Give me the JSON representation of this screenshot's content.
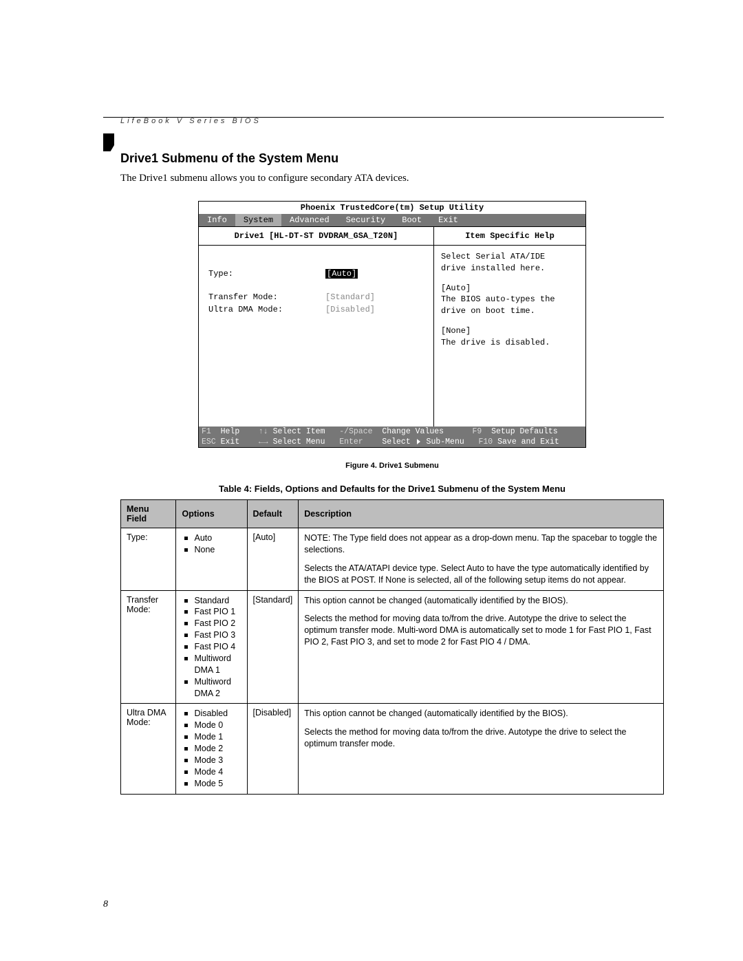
{
  "header": "LifeBook V Series BIOS",
  "section_title": "Drive1 Submenu of the System Menu",
  "lead": "The Drive1 submenu allows you to configure secondary ATA devices.",
  "bios": {
    "title": "Phoenix TrustedCore(tm) Setup Utility",
    "tabs": [
      "Info",
      "System",
      "Advanced",
      "Security",
      "Boot",
      "Exit"
    ],
    "active_tab": "System",
    "submenu_title": "Drive1 [HL-DT-ST DVDRAM_GSA_T20N]",
    "help_title": "Item Specific Help",
    "fields": [
      {
        "label": "Type:",
        "value": "[Auto]",
        "style": "highlight"
      },
      {
        "label": "Transfer Mode:",
        "value": "[Standard]",
        "style": "disabled"
      },
      {
        "label": "Ultra DMA Mode:",
        "value": "[Disabled]",
        "style": "disabled"
      }
    ],
    "help_lines": [
      "Select Serial ATA/IDE",
      "drive installed here.",
      "",
      "[Auto]",
      "The BIOS auto-types the",
      "drive on boot time.",
      "",
      "[None]",
      "The drive is disabled."
    ],
    "footer": {
      "row1": {
        "c1k": "F1",
        "c1l": "Help",
        "c2k": "↑↓",
        "c2l": "Select Item",
        "c3k": "-/Space",
        "c3l": "Change Values",
        "c4k": "F9",
        "c4l": "Setup Defaults"
      },
      "row2": {
        "c1k": "ESC",
        "c1l": "Exit",
        "c2k": "←→",
        "c2l": "Select Menu",
        "c3k": "Enter",
        "c3l": "Select ▶ Sub-Menu",
        "c4k": "F10",
        "c4l": "Save and Exit"
      }
    }
  },
  "figure_caption": "Figure 4.  Drive1 Submenu",
  "table_caption": "Table 4: Fields, Options and Defaults for the Drive1 Submenu of the System Menu",
  "table": {
    "headers": [
      "Menu Field",
      "Options",
      "Default",
      "Description"
    ],
    "rows": [
      {
        "field": "Type:",
        "options": [
          "Auto",
          "None"
        ],
        "default": "[Auto]",
        "description": [
          "NOTE: The Type field does not appear as a drop-down menu. Tap the spacebar to toggle the selections.",
          "Selects the ATA/ATAPI device type. Select Auto to have the type automatically identified by the BIOS at POST. If None is selected, all of the following setup items do not appear."
        ]
      },
      {
        "field": "Transfer Mode:",
        "options": [
          "Standard",
          "Fast PIO 1",
          "Fast PIO 2",
          "Fast PIO 3",
          "Fast PIO 4",
          "Multiword DMA 1",
          "Multiword DMA 2"
        ],
        "default": "[Standard]",
        "description": [
          "This option cannot be changed (automatically identified by the BIOS).",
          "Selects the method for moving data to/from the drive. Autotype the drive to select the optimum transfer mode.  Multi-word DMA is automatically set to mode 1 for Fast PIO 1, Fast PIO 2, Fast PIO 3, and set to mode 2 for Fast PIO 4 / DMA."
        ]
      },
      {
        "field": "Ultra DMA Mode:",
        "options": [
          "Disabled",
          "Mode 0",
          "Mode 1",
          "Mode 2",
          "Mode 3",
          "Mode 4",
          "Mode 5"
        ],
        "default": "[Disabled]",
        "description": [
          "This option cannot be changed (automatically identified by the BIOS).",
          "Selects the method for moving data to/from the drive. Autotype the drive to select the optimum transfer mode."
        ]
      }
    ]
  },
  "page_number": "8"
}
